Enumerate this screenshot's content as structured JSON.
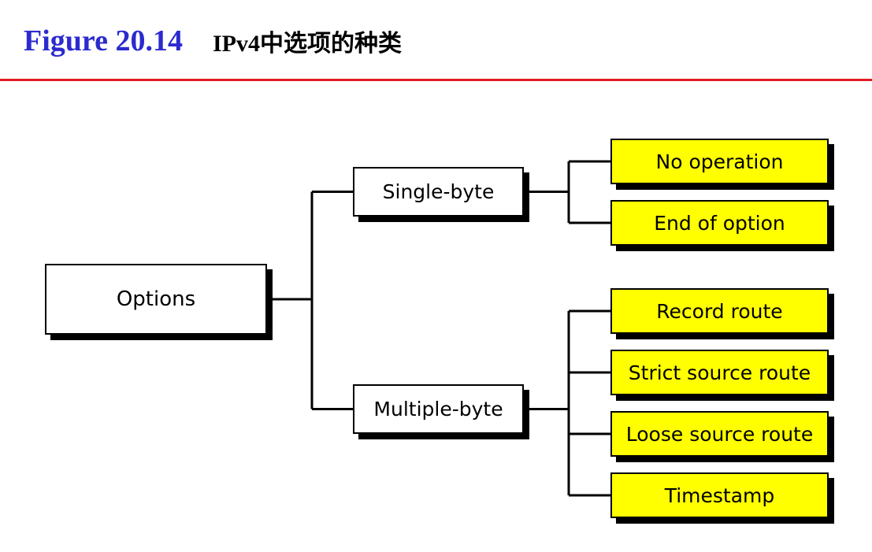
{
  "header": {
    "figure_number": "Figure 20.14",
    "title": "IPv4中选项的种类",
    "figure_number_color": "#2b2bcf",
    "rule_color": "#e01b24"
  },
  "diagram": {
    "root": {
      "label": "Options"
    },
    "categories": [
      {
        "label": "Single-byte",
        "items": [
          "No operation",
          "End of option"
        ]
      },
      {
        "label": "Multiple-byte",
        "items": [
          "Record route",
          "Strict source route",
          "Loose source route",
          "Timestamp"
        ]
      }
    ],
    "colors": {
      "root_fill": "#ffffff",
      "category_fill": "#ffffff",
      "leaf_fill": "#ffff00",
      "line": "#000000",
      "shadow": "#000000"
    }
  }
}
